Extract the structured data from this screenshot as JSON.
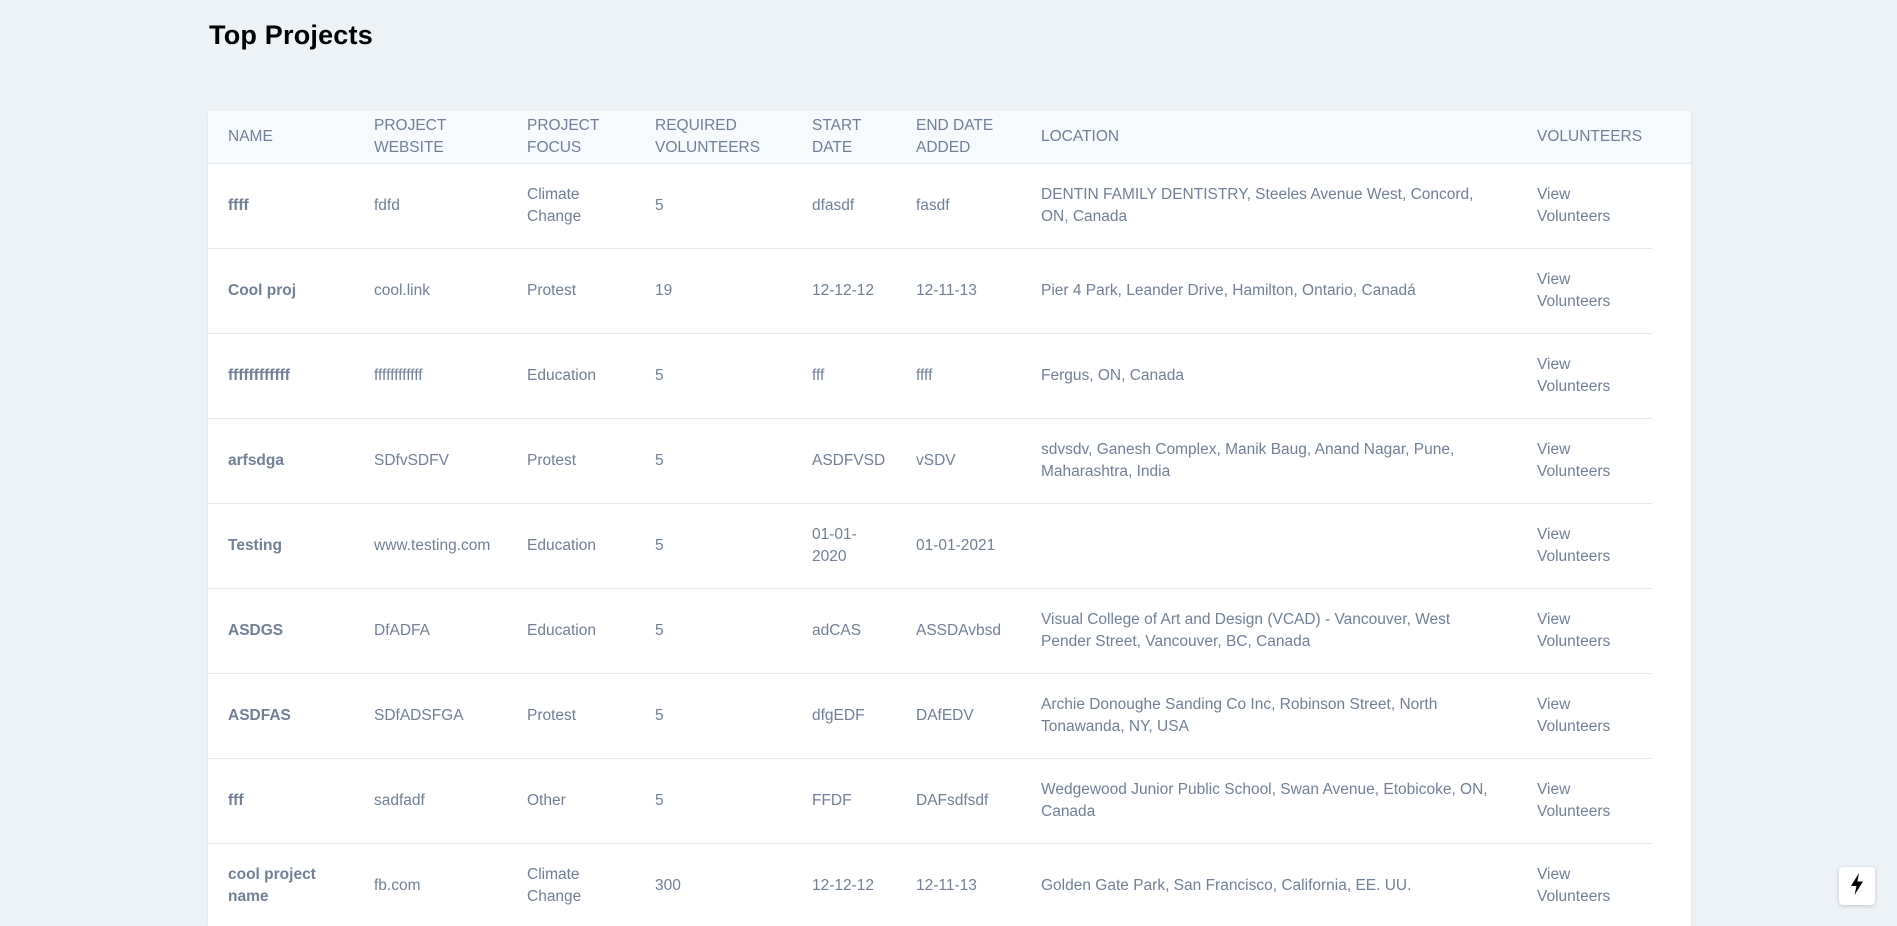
{
  "page": {
    "title": "Top Projects"
  },
  "table": {
    "headers": {
      "name": "NAME",
      "website": "PROJECT WEBSITE",
      "focus": "PROJECT FOCUS",
      "required": "REQUIRED VOLUNTEERS",
      "start": "START DATE",
      "end": "END DATE ADDED",
      "location": "LOCATION",
      "volunteers": "VOLUNTEERS"
    },
    "rows": [
      {
        "name": "ffff",
        "website": "fdfd",
        "focus": "Climate Change",
        "required": "5",
        "start": "dfasdf",
        "end": "fasdf",
        "location": "DENTIN FAMILY DENTISTRY, Steeles Avenue West, Concord, ON, Canada",
        "link": "View Volunteers"
      },
      {
        "name": "Cool proj",
        "website": "cool.link",
        "focus": "Protest",
        "required": "19",
        "start": "12-12-12",
        "end": "12-11-13",
        "location": "Pier 4 Park, Leander Drive, Hamilton, Ontario, Canadá",
        "link": "View Volunteers"
      },
      {
        "name": "ffffffffffff",
        "website": "ffffffffffff",
        "focus": "Education",
        "required": "5",
        "start": "fff",
        "end": "ffff",
        "location": "Fergus, ON, Canada",
        "link": "View Volunteers"
      },
      {
        "name": "arfsdga",
        "website": "SDfvSDFV",
        "focus": "Protest",
        "required": "5",
        "start": "ASDFVSD",
        "end": "vSDV",
        "location": "sdvsdv, Ganesh Complex, Manik Baug, Anand Nagar, Pune, Maharashtra, India",
        "link": "View Volunteers"
      },
      {
        "name": "Testing",
        "website": "www.testing.com",
        "focus": "Education",
        "required": "5",
        "start": "01-01-2020",
        "end": "01-01-2021",
        "location": "",
        "link": "View Volunteers"
      },
      {
        "name": "ASDGS",
        "website": "DfADFA",
        "focus": "Education",
        "required": "5",
        "start": "adCAS",
        "end": "ASSDAvbsd",
        "location": "Visual College of Art and Design (VCAD) - Vancouver, West Pender Street, Vancouver, BC, Canada",
        "link": "View Volunteers"
      },
      {
        "name": "ASDFAS",
        "website": "SDfADSFGA",
        "focus": "Protest",
        "required": "5",
        "start": "dfgEDF",
        "end": "DAfEDV",
        "location": "Archie Donoughe Sanding Co Inc, Robinson Street, North Tonawanda, NY, USA",
        "link": "View Volunteers"
      },
      {
        "name": "fff",
        "website": "sadfadf",
        "focus": "Other",
        "required": "5",
        "start": "FFDF",
        "end": "DAFsdfsdf",
        "location": "Wedgewood Junior Public School, Swan Avenue, Etobicoke, ON, Canada",
        "link": "View Volunteers"
      },
      {
        "name": "cool project name",
        "website": "fb.com",
        "focus": "Climate Change",
        "required": "300",
        "start": "12-12-12",
        "end": "12-11-13",
        "location": "Golden Gate Park, San Francisco, California, EE. UU.",
        "link": "View Volunteers"
      }
    ]
  },
  "fab": {
    "icon": "lightning-bolt-icon"
  }
}
